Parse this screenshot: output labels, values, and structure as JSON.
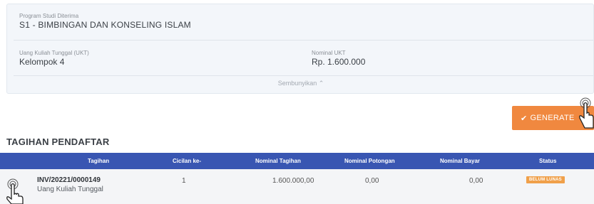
{
  "program": {
    "label": "Program Studi Diterima",
    "value": "S1 - BIMBINGAN DAN KONSELING ISLAM"
  },
  "ukt": {
    "label": "Uang Kuliah Tunggal (UKT)",
    "value": "Kelompok 4"
  },
  "nominal_ukt": {
    "label": "Nominal UKT",
    "value": "Rp. 1.600.000"
  },
  "hide_toggle": "Sembunyikan ⌃",
  "generate_button": "GENERATE",
  "section_title": "TAGIHAN PENDAFTAR",
  "table": {
    "headers": [
      "Tagihan",
      "Cicilan ke-",
      "Nominal Tagihan",
      "Nominal Potongan",
      "Nominal Bayar",
      "Status"
    ],
    "rows": [
      {
        "invoice": "INV/20221/0000149",
        "description": "Uang Kuliah Tunggal",
        "cicilan": "1",
        "nominal_tagihan": "1.600.000,00",
        "nominal_potongan": "0,00",
        "nominal_bayar": "0,00",
        "status": "BELUM LUNAS"
      }
    ]
  },
  "colors": {
    "header_bg": "#3956b2",
    "button_bg": "#f0883f",
    "badge_bg": "#f0a04a",
    "panel_bg": "#f3f6fa"
  },
  "icons": [
    "check-icon",
    "hand-pointer-icon"
  ]
}
